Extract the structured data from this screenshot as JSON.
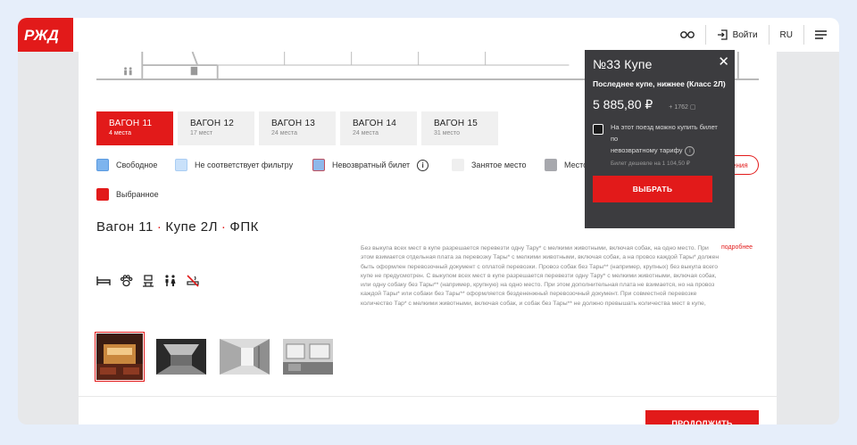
{
  "header": {
    "logo": "РЖД",
    "actions": [
      {
        "icon": "glasses-icon",
        "label": ""
      },
      {
        "icon": "login-icon",
        "label": "Войти"
      },
      {
        "icon": "",
        "label": "RU"
      },
      {
        "icon": "menu-icon",
        "label": ""
      }
    ]
  },
  "wagons": [
    {
      "label": "ВАГОН 11",
      "places": "4 места",
      "active": true
    },
    {
      "label": "ВАГОН 12",
      "places": "17 мест",
      "active": false
    },
    {
      "label": "ВАГОН 13",
      "places": "24 места",
      "active": false
    },
    {
      "label": "ВАГОН 14",
      "places": "24 места",
      "active": false
    },
    {
      "label": "ВАГОН 15",
      "places": "31 место",
      "active": false
    }
  ],
  "legend": [
    {
      "label": "Свободное",
      "color": "#7db4ee"
    },
    {
      "label": "Не соответствует фильтру",
      "color": "#c9e1fa"
    },
    {
      "label": "Невозвратный билет",
      "color": "#8fb8ea"
    },
    {
      "label": "Занятое место",
      "color": "#efefef"
    },
    {
      "label": "Место",
      "color": "#a7a8ad"
    },
    {
      "label": "Выбранное",
      "color": "#e21a1a"
    }
  ],
  "outline_button_fragment": "ения",
  "wagon_title": {
    "number": "Вагон 11",
    "class": "Купе 2Л",
    "carrier": "ФПК"
  },
  "description": "Без выкупа всех мест в купе разрешается перевезти одну Тару* с мелкими животными, включая собак, на одно место. При этом взимается отдельная плата за перевозку Тары* с мелкими животными, включая собак, а на провоз каждой Тары* должен быть оформлен перевозочный документ с оплатой перевозки. Провоз собак без Тары** (например, крупных) без выкупа всего купе не предусмотрен. С выкупом всех мест в купе разрешается перевезти одну Тару* с мелкими животными, включая собак, или одну собаку без Тары** (например, крупную) на одно место. При этом дополнительная плата не взимается, но на провоз каждой Тары* или собаки без Тары** оформляется бездененжный перевозочный документ. При совместной перевозке количество Тар* с мелкими животными, включая собак, и собак без Тары** не должно превышать количества мест в купе,",
  "more_link": "подробнее",
  "amenities": [
    "bed-icon",
    "pet-icon",
    "toilet-icon",
    "wc-icon",
    "no-smoking-icon"
  ],
  "photos": [
    "photo-1",
    "photo-2",
    "photo-3",
    "photo-4"
  ],
  "continue_label": "ПРОДОЛЖИТЬ",
  "popup": {
    "title": "№33 Купе",
    "subtitle": "Последнее купе, нижнее (Класс 2Л)",
    "price": "5 885,80 ₽",
    "bonus": "+ 1762",
    "checkbox_text_1": "На этот поезд можно купить билет по",
    "checkbox_text_2": "невозвратному тарифу",
    "note": "Билет дешевле на 1 104,50 ₽",
    "button": "ВЫБРАТЬ"
  }
}
